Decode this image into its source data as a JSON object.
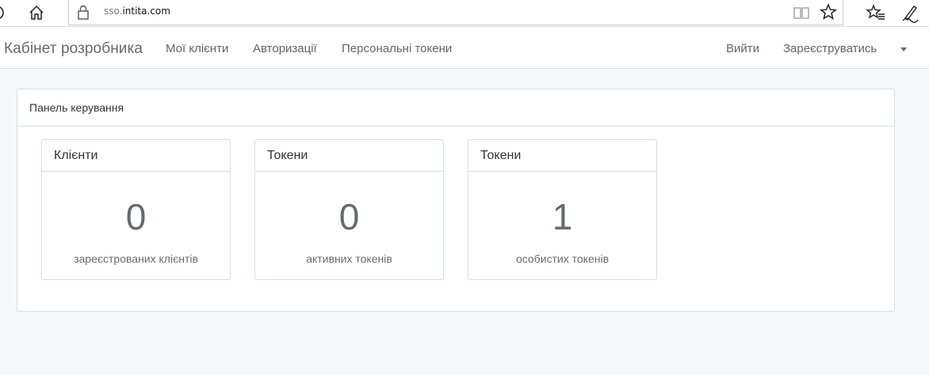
{
  "browser": {
    "url_prefix": "sso.",
    "url_domain": "intita.com"
  },
  "navbar": {
    "brand": "Кабінет розробника",
    "links": [
      "Мої клієнти",
      "Авторизації",
      "Персональні токени"
    ],
    "logout": "Вийти",
    "register": "Зареєструватись"
  },
  "panel": {
    "title": "Панель керування",
    "cards": [
      {
        "title": "Клієнти",
        "value": "0",
        "label": "зареєстрованих клієнтів"
      },
      {
        "title": "Токени",
        "value": "0",
        "label": "активних токенів"
      },
      {
        "title": "Токени",
        "value": "1",
        "label": "особистих токенів"
      }
    ]
  },
  "icons": [
    "refresh-icon",
    "home-icon",
    "lock-icon",
    "reader-view-icon",
    "star-icon",
    "favorites-icon",
    "pen-icon",
    "chevron-down-icon"
  ]
}
